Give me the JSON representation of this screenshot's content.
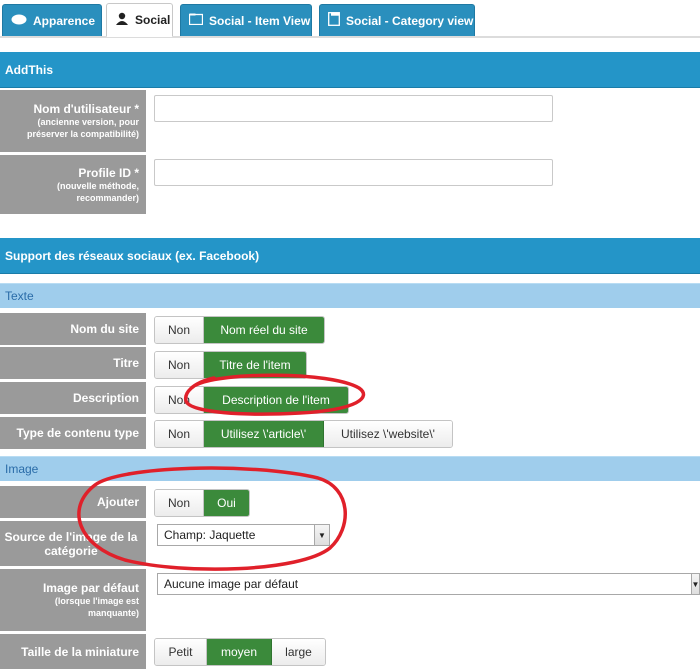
{
  "tabs": [
    {
      "label": "Apparence",
      "icon": "chat-bubble-icon"
    },
    {
      "label": "Social",
      "icon": "user-icon"
    },
    {
      "label": "Social - Item View",
      "icon": "folder-icon"
    },
    {
      "label": "Social - Category view",
      "icon": "document-icon"
    }
  ],
  "addthis": {
    "title": "AddThis",
    "username": {
      "label": "Nom d'utilisateur *",
      "sub": "(ancienne version, pour préserver la compatibilité)",
      "value": ""
    },
    "profile": {
      "label": "Profile ID *",
      "sub": "(nouvelle méthode, recommander)",
      "value": ""
    }
  },
  "social": {
    "title": "Support des réseaux sociaux (ex. Facebook)",
    "texte": {
      "title": "Texte",
      "rows": [
        {
          "label": "Nom du site",
          "options": [
            "Non",
            "Nom réel du site"
          ],
          "selected": 1
        },
        {
          "label": "Titre",
          "options": [
            "Non",
            "Titre de l'item"
          ],
          "selected": 1
        },
        {
          "label": "Description",
          "options": [
            "Non",
            "Description de l'item"
          ],
          "selected": 1
        },
        {
          "label": "Type de contenu type",
          "options": [
            "Non",
            "Utilisez \\'article\\'",
            "Utilisez \\'website\\'"
          ],
          "selected": 1
        }
      ]
    },
    "image": {
      "title": "Image",
      "ajouter": {
        "label": "Ajouter",
        "options": [
          "Non",
          "Oui"
        ],
        "selected": 1
      },
      "source": {
        "label": "Source de l'image de la catégorie",
        "value": "Champ: Jaquette"
      },
      "default": {
        "label": "Image par défaut",
        "sub": "(lorsque l'image est manquante)",
        "value": "Aucune image par défaut"
      },
      "thumb": {
        "label": "Taille de la miniature",
        "options": [
          "Petit",
          "moyen",
          "large"
        ],
        "selected": 1
      }
    }
  },
  "colors": {
    "header": "#2495c8",
    "subheader": "#9fcdec",
    "selected": "#3b8a3b",
    "annotation": "#e0202a"
  }
}
